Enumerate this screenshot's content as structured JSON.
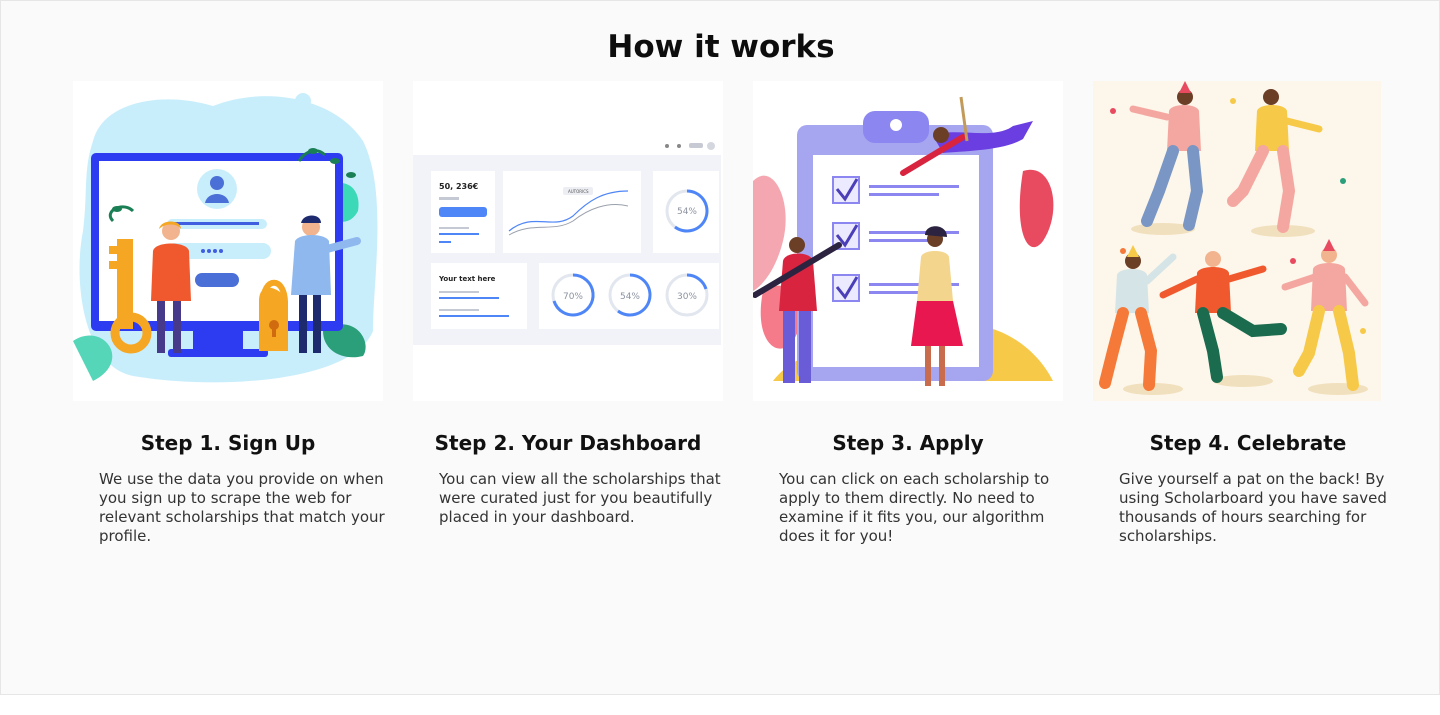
{
  "page": {
    "title": "How it works"
  },
  "steps": [
    {
      "title": "Step 1. Sign Up",
      "description": "We use the data you provide on when you sign up to scrape the web for relevant scholarships that match your profile.",
      "illustration": "sign-up-illustration"
    },
    {
      "title": "Step 2. Your Dashboard",
      "description": "You can view all the scholarships that were curated just for you beautifully placed in your dashboard.",
      "illustration": "dashboard-illustration",
      "mockup": {
        "stat_value": "50, 236€",
        "chip": "AUTORICS",
        "panel_title": "Your text here",
        "gauge_main": "54%",
        "gauges": [
          "70%",
          "54%",
          "30%"
        ]
      }
    },
    {
      "title": "Step 3. Apply",
      "description": "You can click on each scholarship to apply to them directly. No need to examine if it fits you, our algorithm does it for you!",
      "illustration": "apply-checklist-illustration"
    },
    {
      "title": "Step 4. Celebrate",
      "description": "Give yourself a pat on the back! By using Scholarboard you have saved thousands of hours searching for scholarships.",
      "illustration": "celebrate-dancing-illustration"
    }
  ],
  "colors": {
    "background": "#fafafa",
    "accent_blue": "#2d3cf0",
    "accent_orange": "#f5a623",
    "accent_pink": "#f4c6c0",
    "accent_purple": "#8b86f0",
    "dashboard_blue": "#4f86f7"
  }
}
